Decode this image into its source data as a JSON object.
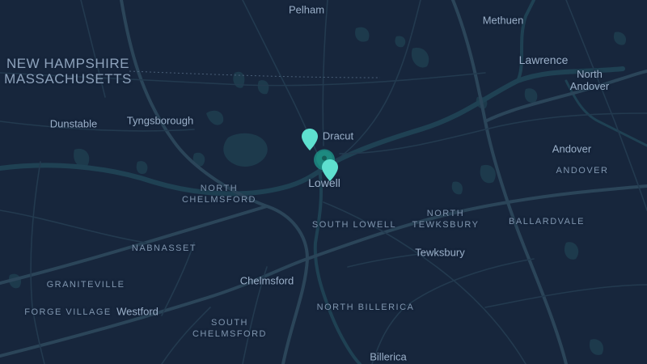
{
  "map": {
    "theme": "dark",
    "colors": {
      "background": "#17263c",
      "water": "#1d3a4c",
      "roads": "#2c4458",
      "pins": "#5ee0cf",
      "cluster": "#1f9a8e"
    },
    "state_labels": [
      "NEW HAMPSHIRE",
      "MASSACHUSETTS"
    ],
    "places": {
      "pelham": "Pelham",
      "methuen": "Methuen",
      "lawrence": "Lawrence",
      "north_andover": "North\nAndover",
      "dunstable": "Dunstable",
      "tyngsborough": "Tyngsborough",
      "dracut": "Dracut",
      "lowell": "Lowell",
      "andover": "Andover",
      "north_chelmsford": "NORTH\nCHELMSFORD",
      "south_lowell": "SOUTH LOWELL",
      "north_tewksbury": "NORTH\nTEWKSBURY",
      "ballardvale": "BALLARDVALE",
      "andover_district": "ANDOVER",
      "nabnasset": "NABNASSET",
      "tewksbury": "Tewksbury",
      "graniteville": "GRANITEVILLE",
      "chelmsford": "Chelmsford",
      "forge_village": "FORGE VILLAGE",
      "westford": "Westford",
      "north_billerica": "NORTH BILLERICA",
      "south_chelmsford": "SOUTH\nCHELMSFORD",
      "billerica": "Billerica"
    },
    "markers": [
      {
        "name": "marker-dracut-pin",
        "icon": "map-pin-icon"
      },
      {
        "name": "marker-lowell-cluster",
        "icon": "cluster-icon"
      },
      {
        "name": "marker-lowell-pin",
        "icon": "map-pin-icon"
      }
    ]
  }
}
